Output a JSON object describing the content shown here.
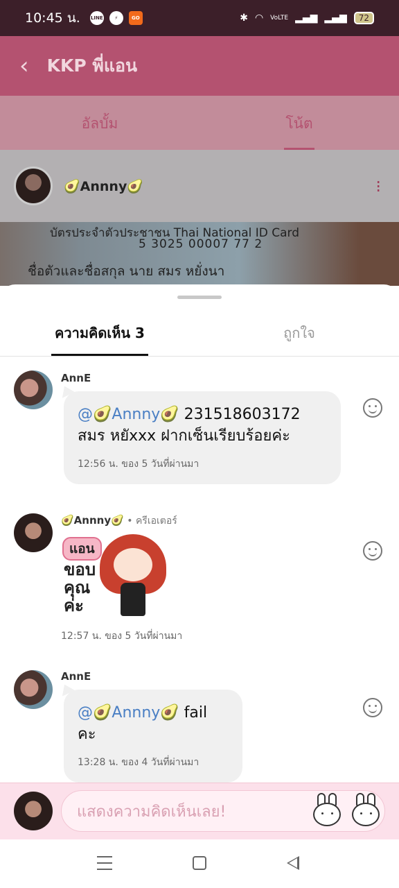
{
  "status_bar": {
    "time": "10:45 น.",
    "icons": [
      "line-icon",
      "messenger-icon",
      "go-app-icon"
    ],
    "right_icons": [
      "bluetooth-icon",
      "wifi-icon",
      "volte-icon",
      "signal-icon",
      "signal-icon"
    ],
    "volte_label": "VoLTE",
    "battery": "72"
  },
  "header": {
    "title": "KKP พี่แอน"
  },
  "tabs": [
    {
      "label": "อัลบั้ม",
      "active": false
    },
    {
      "label": "โน้ต",
      "active": true
    }
  ],
  "post": {
    "author": "🥑Annny🥑",
    "id_card_lines": [
      "บัตรประจำตัวประชาชน Thai National ID Card",
      "5 3025 00007 77 2",
      "ชื่อตัวและชื่อสกุล นาย สมร หยั่งนา"
    ]
  },
  "sheet": {
    "tabs": [
      {
        "label": "ความคิดเห็น 3",
        "active": true
      },
      {
        "label": "ถูกใจ",
        "active": false
      }
    ]
  },
  "comments": [
    {
      "name": "AnnE",
      "mention": "@🥑Annny🥑",
      "text_after_mention": " 231518603172",
      "text_line2": "สมร หยัxxx ฝากเซ็นเรียบร้อยค่ะ",
      "time": "12:56 น. ของ 5 วันที่ผ่านมา"
    },
    {
      "name": "🥑Annny🥑",
      "role": " • ครีเอเตอร์",
      "sticker_tag": "แอน",
      "sticker_text": "ขอบ\nคุณ\nค่ะ",
      "time": "12:57 น. ของ 5 วันที่ผ่านมา"
    },
    {
      "name": "AnnE",
      "mention": "@🥑Annny🥑",
      "text_after_mention": " fail คะ",
      "time": "13:28 น. ของ 4 วันที่ผ่านมา"
    }
  ],
  "input": {
    "placeholder": "แสดงความคิดเห็นเลย!"
  }
}
